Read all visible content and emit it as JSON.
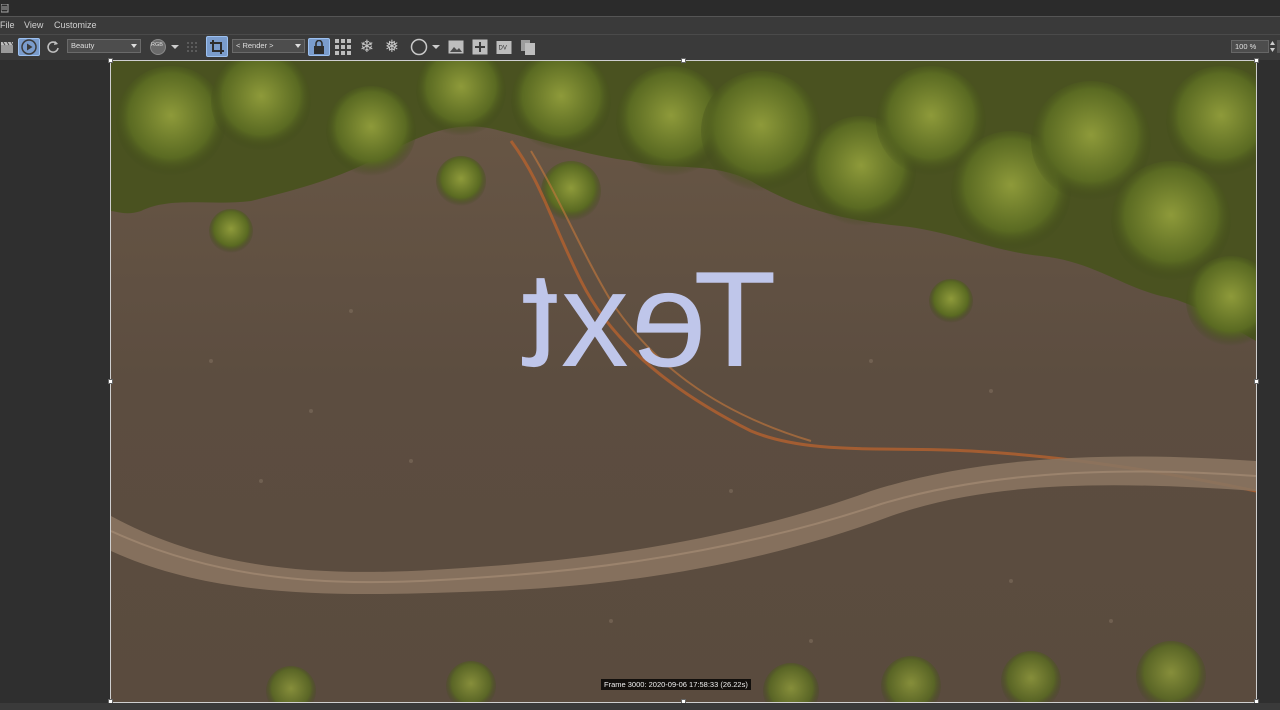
{
  "menu": {
    "items": [
      "File",
      "View",
      "Customize"
    ]
  },
  "toolbar": {
    "render_channel": "Beauty",
    "color_mode": "RGB",
    "render_target": "< Render >",
    "zoom": "100 %"
  },
  "viewport": {
    "overlay_text": "Text",
    "frame_info": "Frame 3000:  2020-09-06  17:58:33  (26.22s)"
  },
  "colors": {
    "accent": "#7a9ccc",
    "overlay_text": "#bfc6ea",
    "background": "#3a3a3a"
  }
}
